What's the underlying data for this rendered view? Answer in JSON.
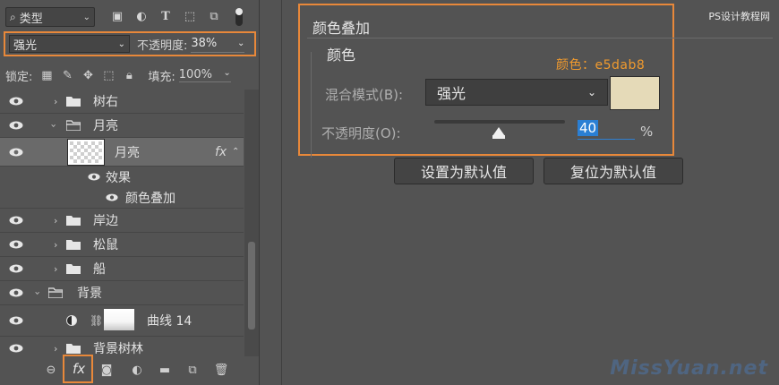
{
  "layers_panel": {
    "filter": {
      "label": "类型"
    },
    "blend": {
      "mode": "强光",
      "opacity_label": "不透明度:",
      "opacity_value": "38%"
    },
    "lock": {
      "label": "锁定:",
      "fill_label": "填充:",
      "fill_value": "100%"
    },
    "layers": [
      {
        "name": "树右",
        "type": "group",
        "depth": 1
      },
      {
        "name": "月亮",
        "type": "group",
        "depth": 1,
        "expanded": true
      },
      {
        "name": "月亮",
        "type": "pixel",
        "depth": 2,
        "selected": true,
        "fx": "fx"
      },
      {
        "name": "效果",
        "type": "effects",
        "depth": 3
      },
      {
        "name": "颜色叠加",
        "type": "effect",
        "depth": 4
      },
      {
        "name": "岸边",
        "type": "group",
        "depth": 1
      },
      {
        "name": "松鼠",
        "type": "group",
        "depth": 1
      },
      {
        "name": "船",
        "type": "group",
        "depth": 1
      },
      {
        "name": "背景",
        "type": "group",
        "depth": 0,
        "expanded": true
      },
      {
        "name": "曲线 14",
        "type": "adjustment",
        "depth": 1
      },
      {
        "name": "背景树林",
        "type": "group",
        "depth": 1
      }
    ],
    "bottom_icons": [
      "link-icon",
      "fx-icon",
      "mask-icon",
      "adjustment-icon",
      "folder-icon",
      "new-layer-icon",
      "trash-icon"
    ],
    "fx_label": "fx"
  },
  "dialog": {
    "group_title": "颜色叠加",
    "sub_title": "颜色",
    "annotation": "颜色：e5dab8",
    "mode_label": "混合模式(B):",
    "mode_value": "强光",
    "swatch_color": "#e5dab8",
    "opacity_label": "不透明度(O):",
    "opacity_value": "40",
    "opacity_unit": "%",
    "buttons": {
      "default": "设置为默认值",
      "reset": "复位为默认值"
    },
    "accent_color": "#e8883a"
  },
  "watermarks": {
    "top": "PS设计教程网",
    "bottom": "MissYuan.net"
  }
}
